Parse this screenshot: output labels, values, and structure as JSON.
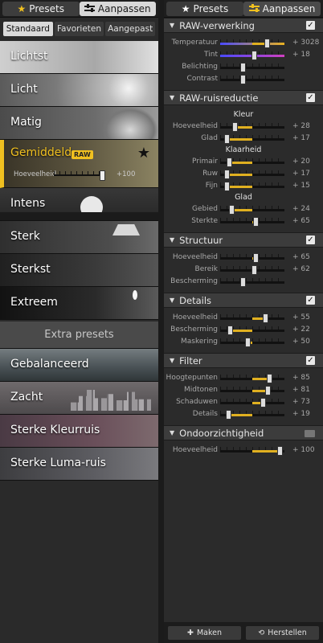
{
  "left": {
    "tabs": [
      {
        "label": "Presets",
        "icon": "star-icon",
        "active": true
      },
      {
        "label": "Aanpassen",
        "icon": "sliders-icon",
        "active": false
      }
    ],
    "subtabs": [
      {
        "label": "Standaard",
        "selected": true
      },
      {
        "label": "Favorieten",
        "selected": false
      },
      {
        "label": "Aangepast",
        "selected": false
      }
    ],
    "presets": [
      {
        "label": "Lichtst"
      },
      {
        "label": "Licht"
      },
      {
        "label": "Matig"
      },
      {
        "label": "Gemiddeld",
        "badge": "RAW",
        "selected": true,
        "favorite": true,
        "amount_label": "Hoeveelheid",
        "amount_value": "+100"
      },
      {
        "label": "Intens"
      },
      {
        "label": "Sterk"
      },
      {
        "label": "Sterkst"
      },
      {
        "label": "Extreem"
      }
    ],
    "extra_header": "Extra presets",
    "extra_presets": [
      {
        "label": "Gebalanceerd"
      },
      {
        "label": "Zacht"
      },
      {
        "label": "Sterke Kleurruis"
      },
      {
        "label": "Sterke Luma-ruis"
      }
    ]
  },
  "right": {
    "tabs": [
      {
        "label": "Presets",
        "icon": "star-icon",
        "active": false
      },
      {
        "label": "Aanpassen",
        "icon": "sliders-icon",
        "active": true
      }
    ],
    "sections": {
      "raw": {
        "title": "RAW-verwerking",
        "checked": true,
        "rows": [
          {
            "label": "Temperatuur",
            "value": "+ 3028",
            "pos": 0.73,
            "color": "#e8b020"
          },
          {
            "label": "Tint",
            "value": "+ 18",
            "pos": 0.52,
            "color": "#d040c0"
          },
          {
            "label": "Belichting",
            "value": "",
            "pos": 0.35
          },
          {
            "label": "Contrast",
            "value": "",
            "pos": 0.35
          }
        ]
      },
      "noise": {
        "title": "RAW-ruisreductie",
        "checked": true,
        "kleur_label": "Kleur",
        "kleur": [
          {
            "label": "Hoeveelheid",
            "value": "+ 28",
            "pos": 0.22
          },
          {
            "label": "Glad",
            "value": "+ 17",
            "pos": 0.1
          }
        ],
        "klaarheid_label": "Klaarheid",
        "klaarheid": [
          {
            "label": "Primair",
            "value": "+ 20",
            "pos": 0.14
          },
          {
            "label": "Ruw",
            "value": "+ 17",
            "pos": 0.1
          },
          {
            "label": "Fijn",
            "value": "+ 15",
            "pos": 0.1
          }
        ],
        "glad_label": "Glad",
        "glad": [
          {
            "label": "Gebied",
            "value": "+ 24",
            "pos": 0.18
          },
          {
            "label": "Sterkte",
            "value": "+ 65",
            "pos": 0.55
          }
        ]
      },
      "structuur": {
        "title": "Structuur",
        "checked": true,
        "rows": [
          {
            "label": "Hoeveelheid",
            "value": "+ 65",
            "pos": 0.55
          },
          {
            "label": "Bereik",
            "value": "+ 62",
            "pos": 0.52
          },
          {
            "label": "Bescherming",
            "value": "",
            "pos": 0.35
          }
        ]
      },
      "details": {
        "title": "Details",
        "checked": true,
        "rows": [
          {
            "label": "Hoeveelheid",
            "value": "+ 55",
            "pos": 0.7
          },
          {
            "label": "Bescherming",
            "value": "+ 22",
            "pos": 0.15
          },
          {
            "label": "Maskering",
            "value": "+ 50",
            "pos": 0.42
          }
        ]
      },
      "filter": {
        "title": "Filter",
        "checked": true,
        "rows": [
          {
            "label": "Hoogtepunten",
            "value": "+ 85",
            "pos": 0.76
          },
          {
            "label": "Midtonen",
            "value": "+ 81",
            "pos": 0.74
          },
          {
            "label": "Schaduwen",
            "value": "+ 73",
            "pos": 0.66
          },
          {
            "label": "Details",
            "value": "+ 19",
            "pos": 0.12
          }
        ]
      },
      "opacity": {
        "title": "Ondoorzichtigheid",
        "checked": false,
        "rows": [
          {
            "label": "Hoeveelheid",
            "value": "+ 100",
            "pos": 0.92
          }
        ]
      }
    },
    "buttons": {
      "make": "Maken",
      "reset": "Herstellen"
    }
  }
}
